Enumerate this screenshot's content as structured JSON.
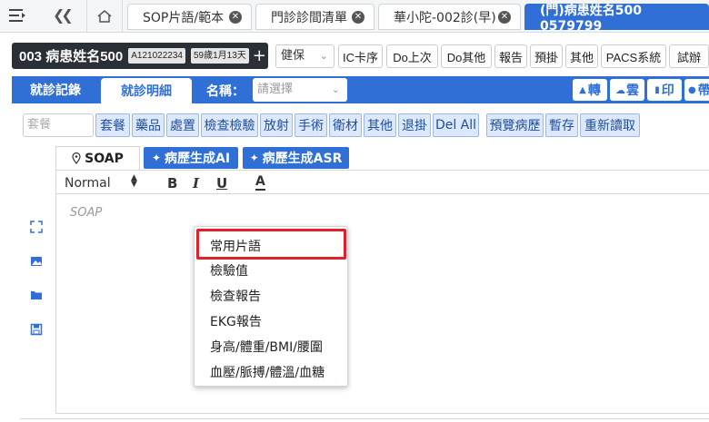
{
  "tabs": [
    {
      "label": "SOP片語/範本"
    },
    {
      "label": "門診診間清單"
    },
    {
      "label": "華小陀-002診(早)"
    },
    {
      "label": "(門)病患姓名500 0579799"
    }
  ],
  "patient": {
    "name": "003 病患姓名500",
    "id": "A121022234",
    "age": "59歲1月13天",
    "add": "+"
  },
  "insurance": {
    "value": "健保"
  },
  "toolbar": [
    "IC卡序",
    "Do上次",
    "Do其他",
    "報告",
    "預掛",
    "其他",
    "PACS系統",
    "試辦"
  ],
  "section": {
    "tabs": [
      "就診記錄",
      "就診明細"
    ],
    "name_label": "名稱：",
    "name_placeholder": "請選擇",
    "right_buttons": [
      "轉",
      "雲",
      "印",
      "帶"
    ]
  },
  "categories": {
    "placeholder": "套餐",
    "buttons": [
      "套餐",
      "藥品",
      "處置",
      "檢查檢驗",
      "放射",
      "手術",
      "衛材",
      "其他",
      "退掛",
      "Del All",
      "預覽病歷",
      "暫存",
      "重新讀取"
    ]
  },
  "soap": {
    "tab": "SOAP",
    "ai_buttons": [
      "病歷生成AI",
      "病歷生成ASR"
    ]
  },
  "editor": {
    "format": "Normal",
    "bold": "B",
    "italic": "I",
    "underline": "U",
    "color": "A",
    "placeholder": "SOAP"
  },
  "context_menu": {
    "items": [
      "常用片語",
      "檢驗值",
      "檢查報告",
      "EKG報告",
      "身高/體重/BMI/腰圍",
      "血壓/脈搏/體溫/血糖"
    ],
    "highlighted_index": 0,
    "highlight_color": "#e0202a"
  },
  "colors": {
    "accent": "#2f6fd6",
    "patient_card": "#2b2f36",
    "category_bg": "#dce8fb"
  }
}
